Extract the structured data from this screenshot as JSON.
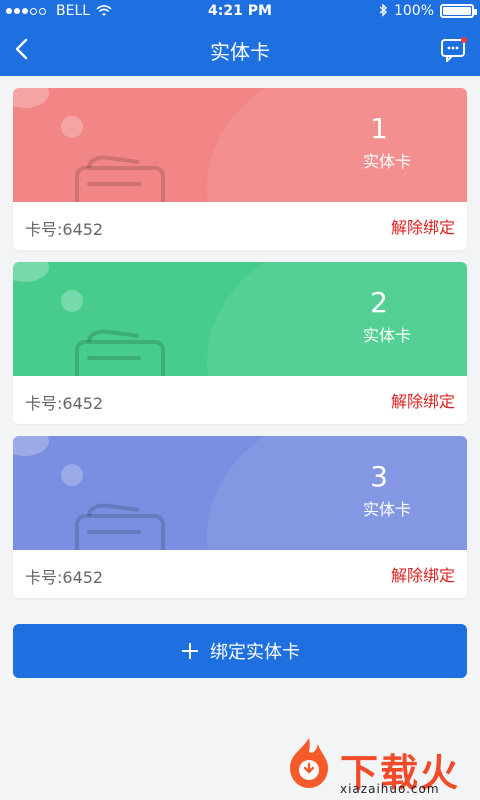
{
  "status_bar": {
    "carrier": "BELL",
    "time": "4:21 PM",
    "battery_text": "100%",
    "battery_level": 1.0
  },
  "nav": {
    "title": "实体卡",
    "back_icon": "chevron-left-icon",
    "message_icon": "chat-bubble-icon"
  },
  "cards": [
    {
      "index": "1",
      "type": "实体卡",
      "card_number": "卡号:6452",
      "action": "解除绑定",
      "color": "#f28686"
    },
    {
      "index": "2",
      "type": "实体卡",
      "card_number": "卡号:6452",
      "action": "解除绑定",
      "color": "#47cc8c"
    },
    {
      "index": "3",
      "type": "实体卡",
      "card_number": "卡号:6452",
      "action": "解除绑定",
      "color": "#7a8fe1"
    }
  ],
  "bind_button": {
    "label": "绑定实体卡",
    "icon": "plus-icon"
  },
  "watermark": {
    "brand": "下载火",
    "url": "xiazaihuo.com"
  },
  "colors": {
    "primary": "#1e6fe0",
    "danger": "#e02020",
    "text_secondary": "#666666",
    "background": "#f3f4f6"
  }
}
